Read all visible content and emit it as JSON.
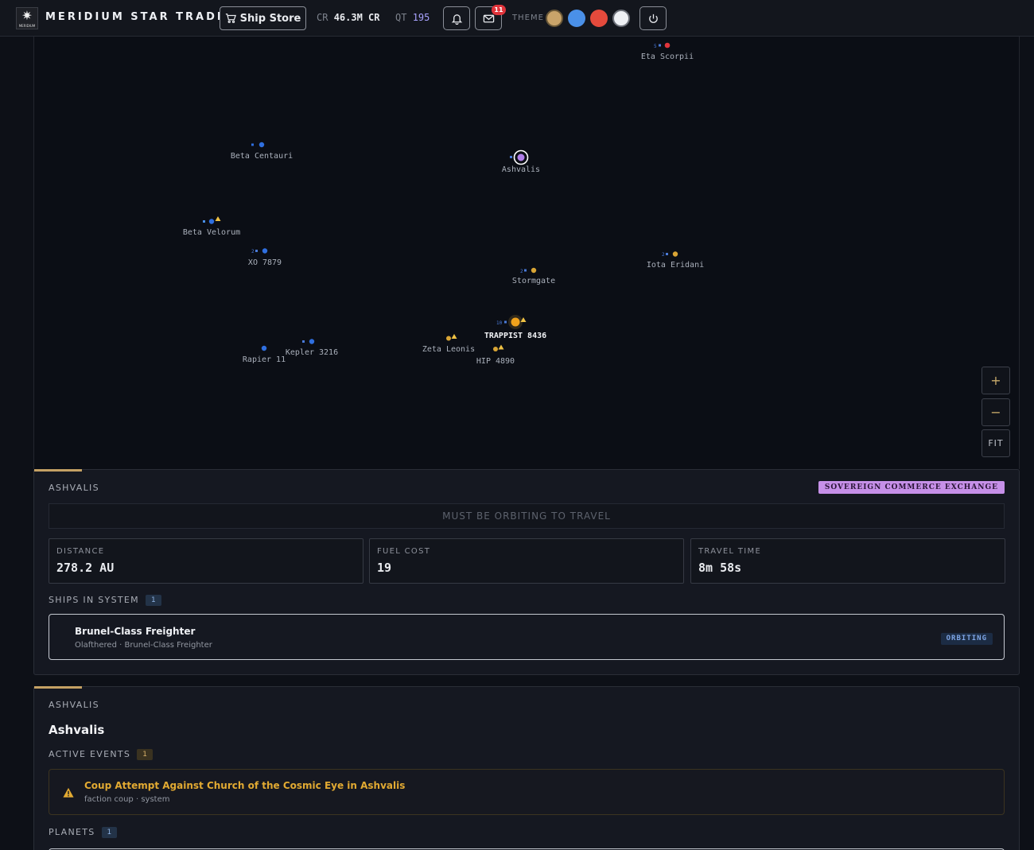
{
  "header": {
    "logo_text": "MERIDIUM",
    "brand": "MERIDIUM STAR TRADERS",
    "store_button": "Ship Store",
    "credits_label": "CR",
    "credits_value": "46.3M CR",
    "qt_label": "QT",
    "qt_value": "195",
    "messages_badge": "11",
    "theme_label": "THEME",
    "theme_swatches": [
      "#c9a46a",
      "#4a90e8",
      "#e54a3c",
      "#eef0f4"
    ]
  },
  "map": {
    "systems": [
      {
        "name": "Eta Scorpii",
        "count": "5"
      },
      {
        "name": "Beta Centauri"
      },
      {
        "name": "Ashvalis",
        "selected": true
      },
      {
        "name": "Beta Velorum"
      },
      {
        "name": "XO 7879",
        "count": "2"
      },
      {
        "name": "Iota Eridani",
        "count": "2"
      },
      {
        "name": "Stormgate",
        "count": "2"
      },
      {
        "name": "TRAPPIST 8436",
        "count": "10",
        "current": true
      },
      {
        "name": "Zeta Leonis"
      },
      {
        "name": "HIP 4890"
      },
      {
        "name": "Kepler 3216"
      },
      {
        "name": "Rapier 11"
      }
    ],
    "zoom_in": "+",
    "zoom_out": "−",
    "fit": "FIT"
  },
  "travel": {
    "section_label": "ASHVALIS",
    "faction_tag": "SOVEREIGN COMMERCE EXCHANGE",
    "notice": "MUST BE ORBITING TO TRAVEL",
    "stats": [
      {
        "label": "DISTANCE",
        "value": "278.2 AU"
      },
      {
        "label": "FUEL COST",
        "value": "19"
      },
      {
        "label": "TRAVEL TIME",
        "value": "8m 58s"
      }
    ],
    "ships_label": "SHIPS IN SYSTEM",
    "ships_count": "1",
    "ship": {
      "name": "Brunel-Class Freighter",
      "sub": "Olafthered · Brunel-Class Freighter",
      "status": "ORBITING"
    }
  },
  "system": {
    "section_label": "ASHVALIS",
    "name": "Ashvalis",
    "events_label": "ACTIVE EVENTS",
    "events_count": "1",
    "event": {
      "title": "Coup Attempt Against Church of the Cosmic Eye in Ashvalis",
      "sub": "faction coup · system"
    },
    "planets_label": "PLANETS",
    "planets_count": "1"
  },
  "colors": {
    "accent": "#c4a164",
    "blue_node": "#2f6fe0",
    "gold_node": "#d9a535",
    "red_node": "#e0343b",
    "selected_node": "#b07ee8"
  }
}
